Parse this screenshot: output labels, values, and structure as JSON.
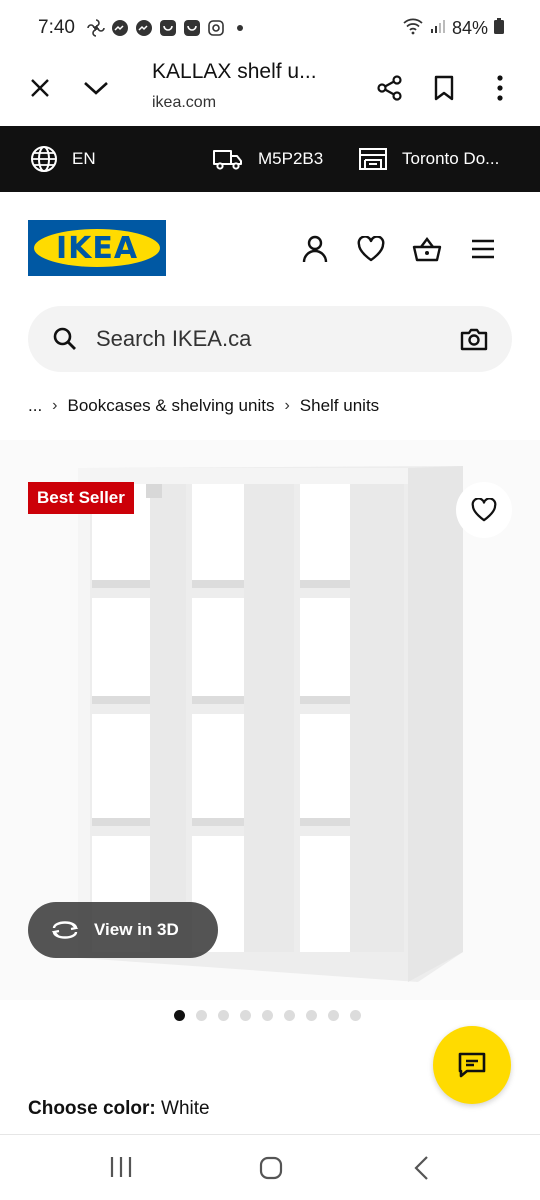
{
  "status_bar": {
    "time": "7:40",
    "battery": "84%"
  },
  "tab_bar": {
    "title": "KALLAX shelf u...",
    "url": "ikea.com"
  },
  "location_bar": {
    "language": "EN",
    "postal_code": "M5P2B3",
    "store": "Toronto Do..."
  },
  "header": {
    "logo_text": "IKEA"
  },
  "search": {
    "placeholder": "Search IKEA.ca"
  },
  "breadcrumb": {
    "ellipsis": "...",
    "items": [
      "Bookcases & shelving units",
      "Shelf units"
    ]
  },
  "product": {
    "badge": "Best Seller",
    "view_3d_label": "View in 3D",
    "image_count": 9,
    "active_image": 1
  },
  "color_option": {
    "label": "Choose color:",
    "value": "White"
  },
  "colors": {
    "ikea_blue": "#0058a3",
    "ikea_yellow": "#ffdb00",
    "badge_red": "#cc0008",
    "topbar_black": "#111111"
  }
}
